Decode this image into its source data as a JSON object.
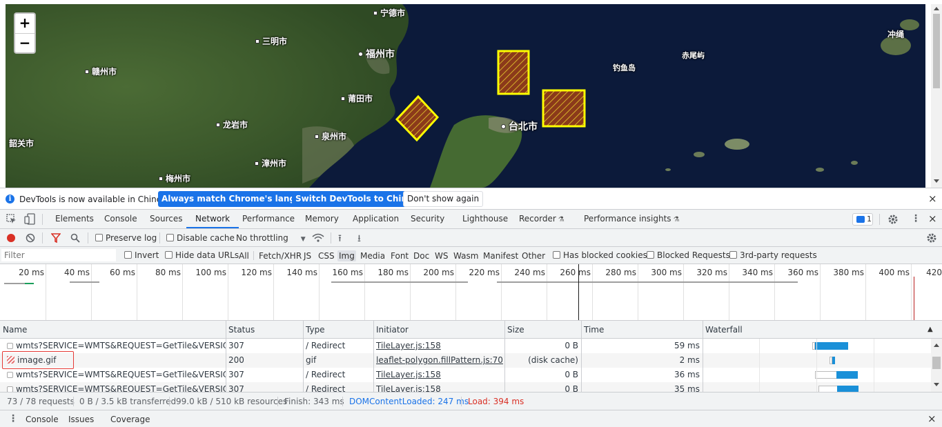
{
  "map": {
    "zoom_in": "+",
    "zoom_out": "−",
    "cities": [
      {
        "name": "宁德市",
        "big": false
      },
      {
        "name": "三明市",
        "big": false
      },
      {
        "name": "福州市",
        "big": true
      },
      {
        "name": "赣州市",
        "big": false
      },
      {
        "name": "莆田市",
        "big": false
      },
      {
        "name": "龙岩市",
        "big": false
      },
      {
        "name": "泉州市",
        "big": false
      },
      {
        "name": "韶关市",
        "big": false
      },
      {
        "name": "漳州市",
        "big": false
      },
      {
        "name": "梅州市",
        "big": false
      },
      {
        "name": "台北市",
        "big": true
      },
      {
        "name": "钓鱼岛",
        "big": false
      },
      {
        "name": "赤尾屿",
        "big": false
      },
      {
        "name": "冲绳",
        "big": false
      }
    ],
    "polygon_stroke": "#ffff00",
    "polygon_fill": "#8b3a1a"
  },
  "infobar": {
    "message": "DevTools is now available in Chinese!",
    "btn_match": "Always match Chrome's language",
    "btn_switch": "Switch DevTools to Chinese",
    "btn_dont": "Don't show again",
    "close": "×"
  },
  "tabs": {
    "items": [
      "Elements",
      "Console",
      "Sources",
      "Network",
      "Performance",
      "Memory",
      "Application",
      "Security",
      "Lighthouse",
      "Recorder",
      "Performance insights"
    ],
    "active": "Network",
    "issues_count": "1"
  },
  "toolbar": {
    "preserve_log": "Preserve log",
    "disable_cache": "Disable cache",
    "throttling": "No throttling"
  },
  "filterbar": {
    "placeholder": "Filter",
    "invert": "Invert",
    "hide_data_urls": "Hide data URLs",
    "types": [
      "All",
      "Fetch/XHR",
      "JS",
      "CSS",
      "Img",
      "Media",
      "Font",
      "Doc",
      "WS",
      "Wasm",
      "Manifest",
      "Other"
    ],
    "selected_type": "Img",
    "has_blocked_cookies": "Has blocked cookies",
    "blocked_requests": "Blocked Requests",
    "third_party": "3rd-party requests"
  },
  "overview": {
    "ticks": [
      "20 ms",
      "40 ms",
      "60 ms",
      "80 ms",
      "100 ms",
      "120 ms",
      "140 ms",
      "160 ms",
      "180 ms",
      "200 ms",
      "220 ms",
      "240 ms",
      "260 ms",
      "280 ms",
      "300 ms",
      "320 ms",
      "340 ms",
      "360 ms",
      "380 ms",
      "400 ms",
      "420"
    ]
  },
  "table": {
    "columns": [
      "Name",
      "Status",
      "Type",
      "Initiator",
      "Size",
      "Time",
      "Waterfall"
    ],
    "rows": [
      {
        "name": "wmts?SERVICE=WMTS&REQUEST=GetTile&VERSION...",
        "status": "307",
        "type": "/ Redirect",
        "initiator": "TileLayer.js:158",
        "size": "0 B",
        "time": "59 ms"
      },
      {
        "name": "image.gif",
        "status": "200",
        "type": "gif",
        "initiator": "leaflet-polygon.fillPattern.js:70",
        "size": "(disk cache)",
        "time": "2 ms"
      },
      {
        "name": "wmts?SERVICE=WMTS&REQUEST=GetTile&VERSION...",
        "status": "307",
        "type": "/ Redirect",
        "initiator": "TileLayer.js:158",
        "size": "0 B",
        "time": "36 ms"
      },
      {
        "name": "wmts?SERVICE=WMTS&REQUEST=GetTile&VERSION...",
        "status": "307",
        "type": "/ Redirect",
        "initiator": "TileLayer.js:158",
        "size": "0 B",
        "time": "35 ms"
      }
    ],
    "highlight_color": "#e53935"
  },
  "status": {
    "requests": "73 / 78 requests",
    "transferred": "0 B / 3.5 kB transferred",
    "resources": "99.0 kB / 510 kB resources",
    "finish": "Finish: 343 ms",
    "dom": "DOMContentLoaded: 247 ms",
    "load": "Load: 394 ms",
    "dom_color": "#1a73e8",
    "load_color": "#d93025"
  },
  "drawer": {
    "tabs": [
      "Console",
      "Issues",
      "Coverage"
    ],
    "close": "×"
  }
}
